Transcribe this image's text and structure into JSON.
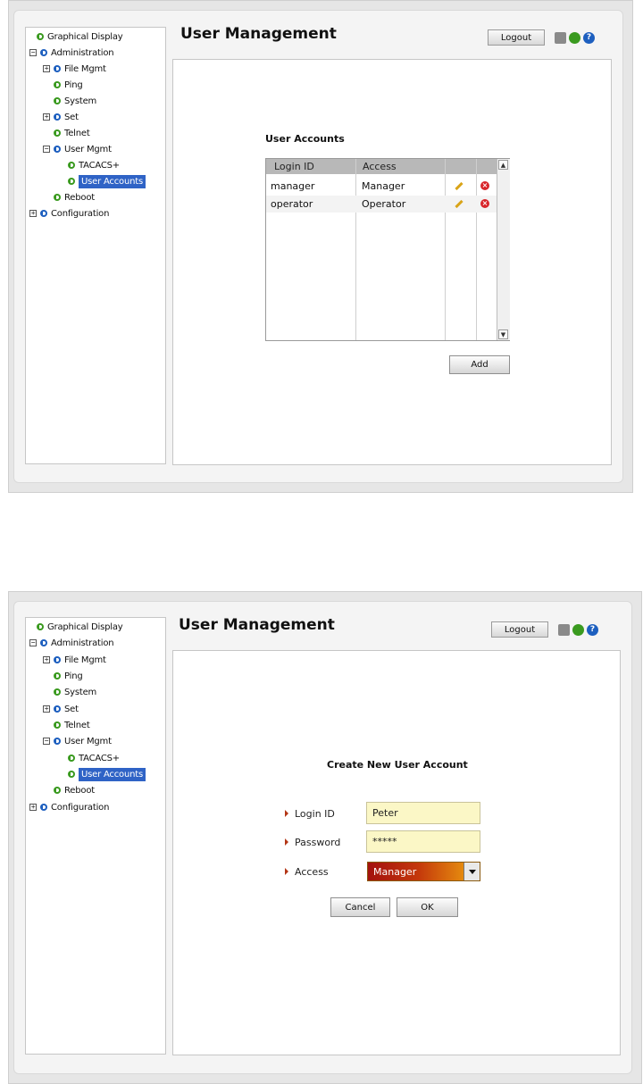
{
  "nav": {
    "items": [
      {
        "label": "Graphical Display"
      },
      {
        "label": "Administration"
      },
      {
        "label": "File Mgmt"
      },
      {
        "label": "Ping"
      },
      {
        "label": "System"
      },
      {
        "label": "Set"
      },
      {
        "label": "Telnet"
      },
      {
        "label": "User Mgmt"
      },
      {
        "label": "TACACS+"
      },
      {
        "label": "User Accounts"
      },
      {
        "label": "Reboot"
      },
      {
        "label": "Configuration"
      }
    ],
    "expand_symbol": "+",
    "collapse_symbol": "−"
  },
  "header": {
    "title": "User Management",
    "logout_label": "Logout",
    "help_glyph": "?"
  },
  "list_screen": {
    "section_title": "User Accounts",
    "columns": [
      "Login ID",
      "Access"
    ],
    "rows": [
      {
        "login": "manager",
        "access": "Manager"
      },
      {
        "login": "operator",
        "access": "Operator"
      }
    ],
    "add_label": "Add"
  },
  "create_screen": {
    "section_title": "Create New User Account",
    "login_label": "Login ID",
    "login_value": "Peter",
    "password_label": "Password",
    "password_value": "*****",
    "access_label": "Access",
    "access_value": "Manager",
    "cancel_label": "Cancel",
    "ok_label": "OK"
  },
  "colors": {
    "selection": "#2f63c6",
    "node_green": "#3a9a1f",
    "node_blue": "#1d5fbf",
    "input_bg": "#fbf7c6",
    "bullet": "#b33616"
  },
  "icons": {
    "toolbar": [
      "save-icon",
      "refresh-icon",
      "help-icon"
    ],
    "row_actions": [
      "edit-pencil-icon",
      "delete-icon"
    ]
  }
}
